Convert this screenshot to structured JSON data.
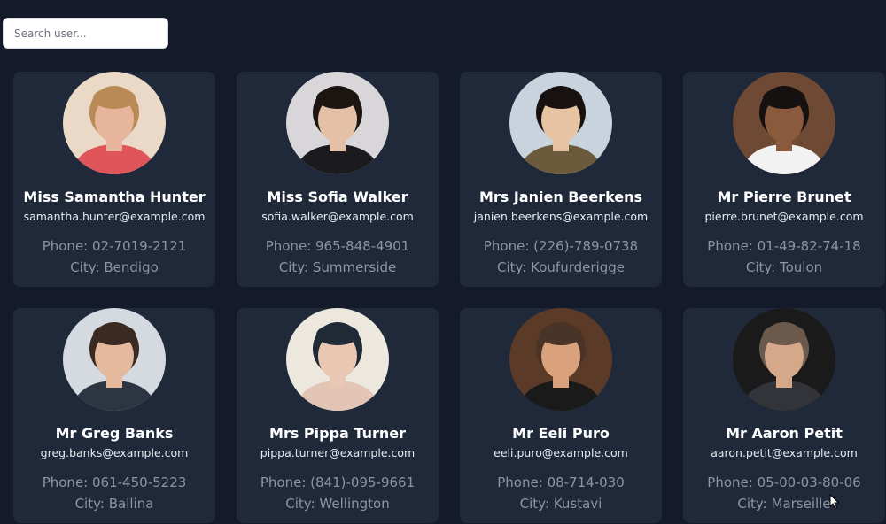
{
  "search": {
    "placeholder": "Search user..."
  },
  "labels": {
    "phone": "Phone:",
    "city": "City:"
  },
  "users": [
    {
      "name": "Miss Samantha Hunter",
      "email": "samantha.hunter@example.com",
      "phone": "02-7019-2121",
      "city": "Bendigo",
      "skin": "#e7b59b",
      "hair": "#b98a55",
      "bg": "#e9d9c6",
      "shirt": "#e0555a"
    },
    {
      "name": "Miss Sofia Walker",
      "email": "sofia.walker@example.com",
      "phone": "965-848-4901",
      "city": "Summerside",
      "skin": "#e3c0a6",
      "hair": "#1c1512",
      "bg": "#d9d6d9",
      "shirt": "#1b1b1f"
    },
    {
      "name": "Mrs Janien Beerkens",
      "email": "janien.beerkens@example.com",
      "phone": "(226)-789-0738",
      "city": "Koufurderigge",
      "skin": "#e6c3a3",
      "hair": "#17110f",
      "bg": "#c9d3dd",
      "shirt": "#6b5a3b"
    },
    {
      "name": "Mr Pierre Brunet",
      "email": "pierre.brunet@example.com",
      "phone": "01-49-82-74-18",
      "city": "Toulon",
      "skin": "#8a5a3c",
      "hair": "#151110",
      "bg": "#6e4a34",
      "shirt": "#f2f2f2"
    },
    {
      "name": "Mr Greg Banks",
      "email": "greg.banks@example.com",
      "phone": "061-450-5223",
      "city": "Ballina",
      "skin": "#e4b99d",
      "hair": "#3a2a22",
      "bg": "#d5dae0",
      "shirt": "#2d3442"
    },
    {
      "name": "Mrs Pippa Turner",
      "email": "pippa.turner@example.com",
      "phone": "(841)-095-9661",
      "city": "Wellington",
      "skin": "#e9c7b3",
      "hair": "#1f2a36",
      "bg": "#ece8de",
      "shirt": "#e3c5b5"
    },
    {
      "name": "Mr Eeli Puro",
      "email": "eeli.puro@example.com",
      "phone": "08-714-030",
      "city": "Kustavi",
      "skin": "#d9a27c",
      "hair": "#4a3428",
      "bg": "#5c3a28",
      "shirt": "#1a1a1a"
    },
    {
      "name": "Mr Aaron Petit",
      "email": "aaron.petit@example.com",
      "phone": "05-00-03-80-06",
      "city": "Marseille",
      "skin": "#d6a88a",
      "hair": "#6b5a4c",
      "bg": "#1a1a1a",
      "shirt": "#333439"
    }
  ]
}
